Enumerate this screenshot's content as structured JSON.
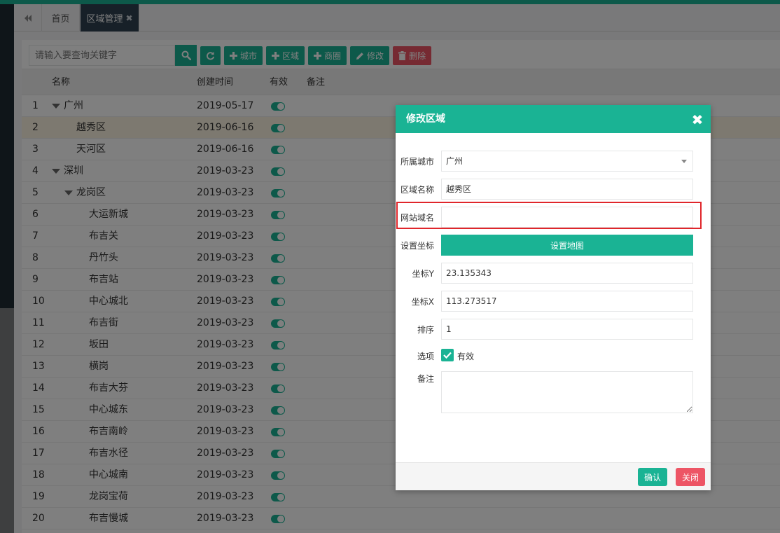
{
  "tabs": {
    "home": "首页",
    "active": "区域管理",
    "active_close": "✖"
  },
  "toolbar": {
    "search_placeholder": "请输入要查询关键字",
    "add_city": "城市",
    "add_area": "区域",
    "add_business": "商圈",
    "edit": "修改",
    "delete": "删除"
  },
  "table": {
    "headers": {
      "name": "名称",
      "created": "创建时间",
      "valid": "有效",
      "remark": "备注"
    },
    "rows": [
      {
        "num": "1",
        "name": "广州",
        "date": "2019-05-17",
        "level": 0,
        "expanded": true
      },
      {
        "num": "2",
        "name": "越秀区",
        "date": "2019-06-16",
        "level": 1,
        "expanded": false,
        "selected": true
      },
      {
        "num": "3",
        "name": "天河区",
        "date": "2019-06-16",
        "level": 1,
        "expanded": false
      },
      {
        "num": "4",
        "name": "深圳",
        "date": "2019-03-23",
        "level": 0,
        "expanded": true
      },
      {
        "num": "5",
        "name": "龙岗区",
        "date": "2019-03-23",
        "level": 1,
        "expanded": true
      },
      {
        "num": "6",
        "name": "大运新城",
        "date": "2019-03-23",
        "level": 2,
        "expanded": false
      },
      {
        "num": "7",
        "name": "布吉关",
        "date": "2019-03-23",
        "level": 2,
        "expanded": false
      },
      {
        "num": "8",
        "name": "丹竹头",
        "date": "2019-03-23",
        "level": 2,
        "expanded": false
      },
      {
        "num": "9",
        "name": "布吉站",
        "date": "2019-03-23",
        "level": 2,
        "expanded": false
      },
      {
        "num": "10",
        "name": "中心城北",
        "date": "2019-03-23",
        "level": 2,
        "expanded": false
      },
      {
        "num": "11",
        "name": "布吉街",
        "date": "2019-03-23",
        "level": 2,
        "expanded": false
      },
      {
        "num": "12",
        "name": "坂田",
        "date": "2019-03-23",
        "level": 2,
        "expanded": false
      },
      {
        "num": "13",
        "name": "横岗",
        "date": "2019-03-23",
        "level": 2,
        "expanded": false
      },
      {
        "num": "14",
        "name": "布吉大芬",
        "date": "2019-03-23",
        "level": 2,
        "expanded": false
      },
      {
        "num": "15",
        "name": "中心城东",
        "date": "2019-03-23",
        "level": 2,
        "expanded": false
      },
      {
        "num": "16",
        "name": "布吉南岭",
        "date": "2019-03-23",
        "level": 2,
        "expanded": false
      },
      {
        "num": "17",
        "name": "布吉水径",
        "date": "2019-03-23",
        "level": 2,
        "expanded": false
      },
      {
        "num": "18",
        "name": "中心城南",
        "date": "2019-03-23",
        "level": 2,
        "expanded": false
      },
      {
        "num": "19",
        "name": "龙岗宝荷",
        "date": "2019-03-23",
        "level": 2,
        "expanded": false
      },
      {
        "num": "20",
        "name": "布吉慢城",
        "date": "2019-03-23",
        "level": 2,
        "expanded": false
      }
    ]
  },
  "modal": {
    "title": "修改区域",
    "close_glyph": "✖",
    "city_label": "所属城市",
    "city_value": "广州",
    "area_label": "区域名称",
    "area_value": "越秀区",
    "domain_label": "网站域名",
    "domain_value": "",
    "coord_label": "设置坐标",
    "map_button": "设置地图",
    "lat_label": "坐标Y",
    "lat_value": "23.135343",
    "lng_label": "坐标X",
    "lng_value": "113.273517",
    "order_label": "排序",
    "order_value": "1",
    "option_label": "选项",
    "valid_label": "有效",
    "remark_label": "备注",
    "confirm": "确认",
    "cancel": "关闭"
  },
  "colors": {
    "primary": "#1ab394",
    "danger": "#ed5565",
    "highlight": "#e0262b",
    "nav": "#2f4050"
  }
}
